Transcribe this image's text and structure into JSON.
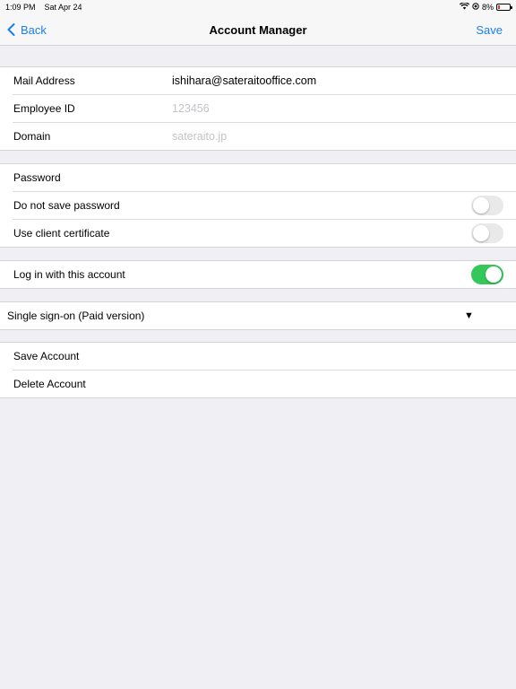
{
  "status_bar": {
    "time": "1:09 PM",
    "date": "Sat Apr 24",
    "battery": "8%"
  },
  "nav": {
    "back_label": "Back",
    "title": "Account Manager",
    "save_label": "Save"
  },
  "account": {
    "mail_label": "Mail Address",
    "mail_value": "ishihara@sateraitooffice.com",
    "employee_label": "Employee ID",
    "employee_placeholder": "123456",
    "domain_label": "Domain",
    "domain_placeholder": "sateraito.jp"
  },
  "security": {
    "password_label": "Password",
    "no_save_label": "Do not save password",
    "no_save_on": false,
    "client_cert_label": "Use client certificate",
    "client_cert_on": false
  },
  "login": {
    "label": "Log in with this account",
    "on": true
  },
  "sso": {
    "selected": "Single sign-on (Paid version)",
    "arrow": "▼"
  },
  "actions": {
    "save_label": "Save Account",
    "delete_label": "Delete Account"
  },
  "colors": {
    "accent": "#1a7ef0",
    "toggle_on": "#34c759",
    "toggle_off": "#e9e9ea",
    "background": "#efeff4"
  }
}
